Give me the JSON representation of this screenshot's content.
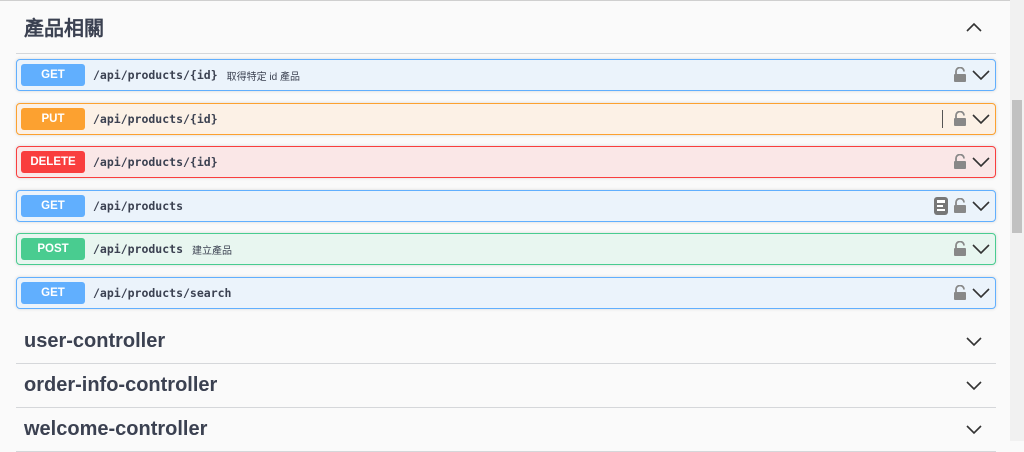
{
  "section": {
    "title": "產品相關",
    "collapse_icon": "chevron-up-icon"
  },
  "operations": [
    {
      "method": "GET",
      "path": "/api/products/{id}",
      "summary": "取得特定 id 產品"
    },
    {
      "method": "PUT",
      "path": "/api/products/{id}",
      "summary": ""
    },
    {
      "method": "DELETE",
      "path": "/api/products/{id}",
      "summary": ""
    },
    {
      "method": "GET",
      "path": "/api/products",
      "summary": ""
    },
    {
      "method": "POST",
      "path": "/api/products",
      "summary": "建立產品"
    },
    {
      "method": "GET",
      "path": "/api/products/search",
      "summary": ""
    }
  ],
  "tags": [
    {
      "title": "user-controller"
    },
    {
      "title": "order-info-controller"
    },
    {
      "title": "welcome-controller"
    }
  ],
  "colors": {
    "get": "#61affe",
    "put": "#fca130",
    "delete": "#f93e3e",
    "post": "#49cc90"
  }
}
